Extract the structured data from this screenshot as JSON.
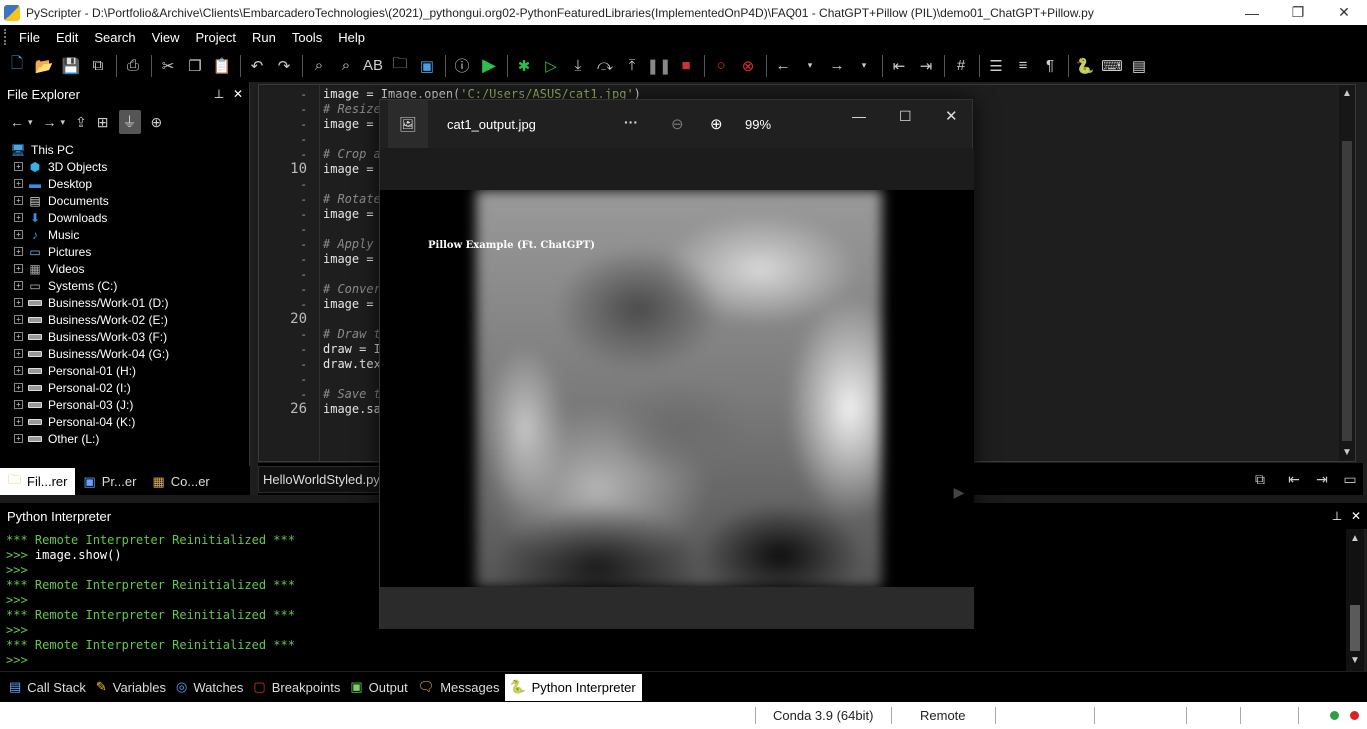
{
  "window": {
    "title": "PyScripter - D:\\Portfolio&Archive\\Clients\\EmbarcaderoTechnologies\\(2021)_pythongui.org02-PythonFeaturedLibraries(ImplementedOnP4D)\\FAQ01 - ChatGPT+Pillow (PIL)\\demo01_ChatGPT+Pillow.py",
    "minimize_glyph": "—",
    "restore_glyph": "❐",
    "close_glyph": "✕"
  },
  "menu": [
    "File",
    "Edit",
    "Search",
    "View",
    "Project",
    "Run",
    "Tools",
    "Help"
  ],
  "file_explorer": {
    "title": "File Explorer",
    "pin_glyph": "⊥",
    "close_glyph": "✕",
    "root": "This PC",
    "items": [
      {
        "label": "3D Objects",
        "icon": "cube-icon"
      },
      {
        "label": "Desktop",
        "icon": "desktop-icon"
      },
      {
        "label": "Documents",
        "icon": "document-icon"
      },
      {
        "label": "Downloads",
        "icon": "download-icon"
      },
      {
        "label": "Music",
        "icon": "music-icon"
      },
      {
        "label": "Pictures",
        "icon": "pictures-icon"
      },
      {
        "label": "Videos",
        "icon": "videos-icon"
      },
      {
        "label": "Systems (C:)",
        "icon": "system-drive-icon"
      },
      {
        "label": "Business/Work-01 (D:)",
        "icon": "drive-icon"
      },
      {
        "label": "Business/Work-02 (E:)",
        "icon": "drive-icon"
      },
      {
        "label": "Business/Work-03 (F:)",
        "icon": "drive-icon"
      },
      {
        "label": "Business/Work-04 (G:)",
        "icon": "drive-icon"
      },
      {
        "label": "Personal-01 (H:)",
        "icon": "drive-icon"
      },
      {
        "label": "Personal-02 (I:)",
        "icon": "drive-icon"
      },
      {
        "label": "Personal-03 (J:)",
        "icon": "drive-icon"
      },
      {
        "label": "Personal-04 (K:)",
        "icon": "drive-icon"
      },
      {
        "label": "Other (L:)",
        "icon": "drive-icon"
      }
    ],
    "tabs": [
      "Fil...rer",
      "Pr...er",
      "Co...er"
    ]
  },
  "editor": {
    "gutter": [
      {
        "text": "-"
      },
      {
        "text": "-"
      },
      {
        "text": "-"
      },
      {
        "text": "-"
      },
      {
        "text": "-"
      },
      {
        "text": "10"
      },
      {
        "text": "-"
      },
      {
        "text": "-"
      },
      {
        "text": "-"
      },
      {
        "text": "-"
      },
      {
        "text": "-"
      },
      {
        "text": "-"
      },
      {
        "text": "-"
      },
      {
        "text": "-"
      },
      {
        "text": "-"
      },
      {
        "text": "20"
      },
      {
        "text": "-"
      },
      {
        "text": "-"
      },
      {
        "text": "-"
      },
      {
        "text": "-"
      },
      {
        "text": "-"
      },
      {
        "text": "26"
      }
    ],
    "line1_code": "image = Image.open(",
    "line1_string": "'C:/Users/ASUS/cat1.jpg'",
    "line1_close": ")",
    "code_lines": [
      {
        "row": 2,
        "text": "# Resize",
        "comment": true
      },
      {
        "row": 3,
        "text": "image =",
        "comment": false
      },
      {
        "row": 5,
        "text": "# Crop a",
        "comment": true
      },
      {
        "row": 6,
        "text": "image =",
        "comment": false
      },
      {
        "row": 8,
        "text": "# Rotate",
        "comment": true
      },
      {
        "row": 9,
        "text": "image =",
        "comment": false
      },
      {
        "row": 11,
        "text": "# Apply",
        "comment": true
      },
      {
        "row": 12,
        "text": "image =",
        "comment": false
      },
      {
        "row": 14,
        "text": "# Conver",
        "comment": true
      },
      {
        "row": 15,
        "text": "image =",
        "comment": false
      },
      {
        "row": 17,
        "text": "# Draw t",
        "comment": true
      },
      {
        "row": 18,
        "text": "draw = I",
        "comment": false
      },
      {
        "row": 19,
        "text": "draw.tex",
        "comment": false
      },
      {
        "row": 21,
        "text": "# Save t",
        "comment": true
      },
      {
        "row": 22,
        "text": "image.sa",
        "comment": false
      }
    ],
    "open_tab": "HelloWorldStyled.py"
  },
  "interpreter": {
    "title": "Python Interpreter",
    "lines": [
      {
        "text": "*** Remote Interpreter Reinitialized ***",
        "color": "green"
      },
      {
        "text": ">>> ",
        "color": "green",
        "cmd": "image.show()"
      },
      {
        "text": ">>>",
        "color": "green"
      },
      {
        "text": "*** Remote Interpreter Reinitialized ***",
        "color": "green"
      },
      {
        "text": ">>>",
        "color": "green"
      },
      {
        "text": "*** Remote Interpreter Reinitialized ***",
        "color": "green"
      },
      {
        "text": ">>>",
        "color": "green"
      },
      {
        "text": "*** Remote Interpreter Reinitialized ***",
        "color": "green"
      },
      {
        "text": ">>>",
        "color": "green"
      }
    ]
  },
  "bottom_tabs": [
    {
      "label": "Call Stack",
      "icon": "call-stack-icon"
    },
    {
      "label": "Variables",
      "icon": "variables-icon"
    },
    {
      "label": "Watches",
      "icon": "watches-icon"
    },
    {
      "label": "Breakpoints",
      "icon": "breakpoints-icon"
    },
    {
      "label": "Output",
      "icon": "output-icon"
    },
    {
      "label": "Messages",
      "icon": "messages-icon"
    },
    {
      "label": "Python Interpreter",
      "icon": "python-icon",
      "active": true
    }
  ],
  "statusbar": {
    "python_version": "Conda 3.9 (64bit)",
    "engine": "Remote"
  },
  "viewer": {
    "filename": "cat1_output.jpg",
    "more_glyph": "···",
    "zoom_level": "99%",
    "caption": "Pillow Example (Ft. ChatGPT)"
  },
  "colors": {
    "comment": "#8b8b8b",
    "string": "#9ec16f",
    "interpreter_green": "#61c84a",
    "status_ok": "#2ea043",
    "status_error": "#e02020"
  }
}
